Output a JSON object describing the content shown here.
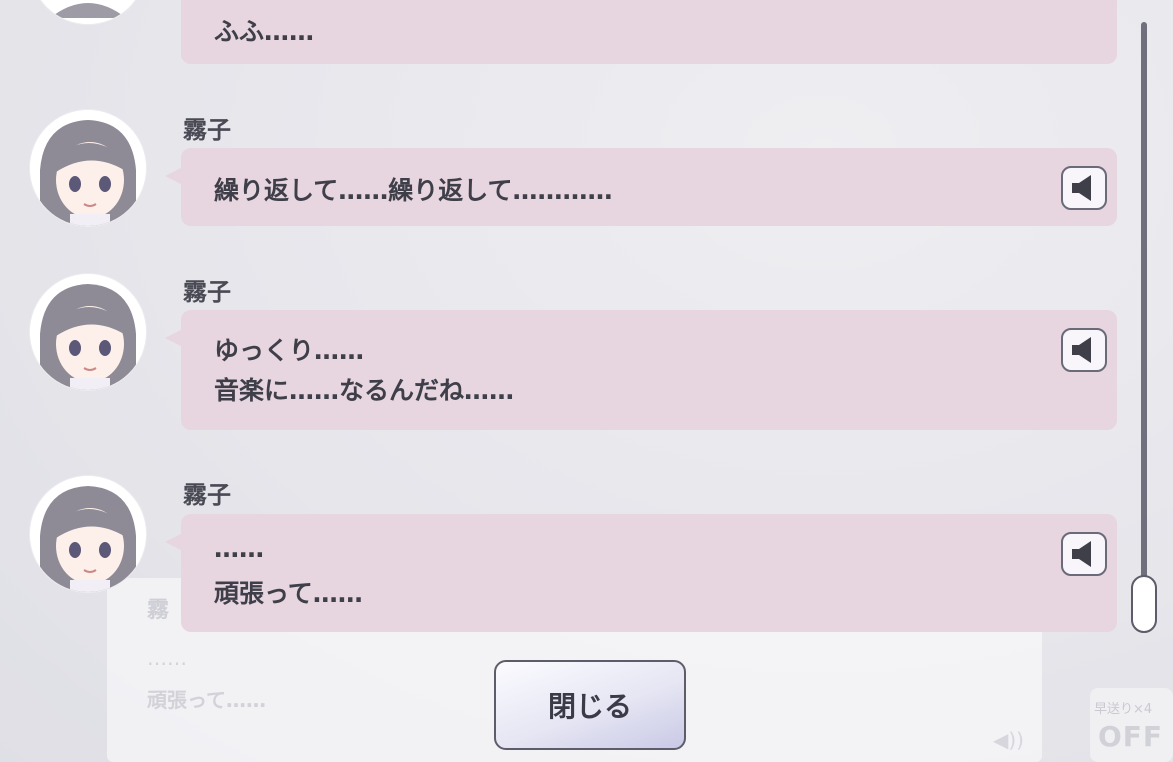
{
  "background": {
    "dialog_name": "霧",
    "dialog_line1": "……",
    "dialog_line2": "頑張って……",
    "fast_forward_label": "早送り×4",
    "fast_forward_state": "OFF"
  },
  "log": {
    "entries": [
      {
        "speaker": "",
        "lines": [
          "ふふ……"
        ],
        "has_voice": false
      },
      {
        "speaker": "霧子",
        "lines": [
          "繰り返して……繰り返して…………"
        ],
        "has_voice": true
      },
      {
        "speaker": "霧子",
        "lines": [
          "ゆっくり……",
          "音楽に……なるんだね……"
        ],
        "has_voice": true
      },
      {
        "speaker": "霧子",
        "lines": [
          "……",
          "頑張って……"
        ],
        "has_voice": true
      }
    ]
  },
  "close_button": {
    "label": "閉じる"
  },
  "icons": {
    "voice": "speaker-icon",
    "volume": "volume-icon"
  },
  "colors": {
    "bubble": "#e7d5df",
    "text": "#3f3f4a",
    "scrollbar": "#6f6f7d"
  }
}
